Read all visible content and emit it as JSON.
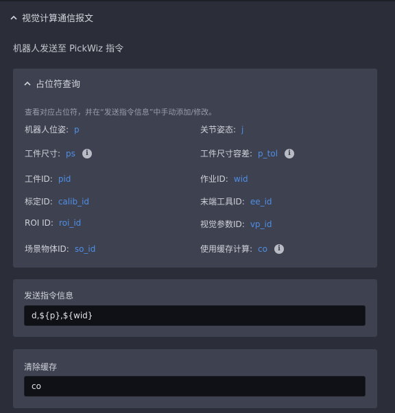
{
  "section": {
    "title": "视觉计算通信报文"
  },
  "subtitle": "机器人发送至 PickWiz 指令",
  "placeholder_panel": {
    "title": "占位符查询",
    "hint": "查看对应占位符，并在“发送指令信息”中手动添加/修改。",
    "fields": [
      {
        "label": "机器人位姿:",
        "value": "p"
      },
      {
        "label": "关节姿态:",
        "value": "j"
      },
      {
        "label": "工件尺寸:",
        "value": "ps"
      },
      {
        "label": "工件尺寸容差:",
        "value": "p_tol"
      },
      {
        "label": "工件ID:",
        "value": "pid"
      },
      {
        "label": "作业ID:",
        "value": "wid"
      },
      {
        "label": "标定ID:",
        "value": "calib_id"
      },
      {
        "label": "末端工具ID:",
        "value": "ee_id"
      },
      {
        "label": "ROI ID:",
        "value": "roi_id"
      },
      {
        "label": "视觉参数ID:",
        "value": "vp_id"
      },
      {
        "label": "场景物体ID:",
        "value": "so_id"
      },
      {
        "label": "使用缓存计算:",
        "value": "co"
      }
    ]
  },
  "send_info": {
    "label": "发送指令信息",
    "value": "d,${p},${wid}"
  },
  "clear_cache": {
    "label": "清除缓存",
    "value": "co"
  },
  "icons": {
    "info": "info-circle-icon",
    "collapse": "chevron-up-icon"
  }
}
